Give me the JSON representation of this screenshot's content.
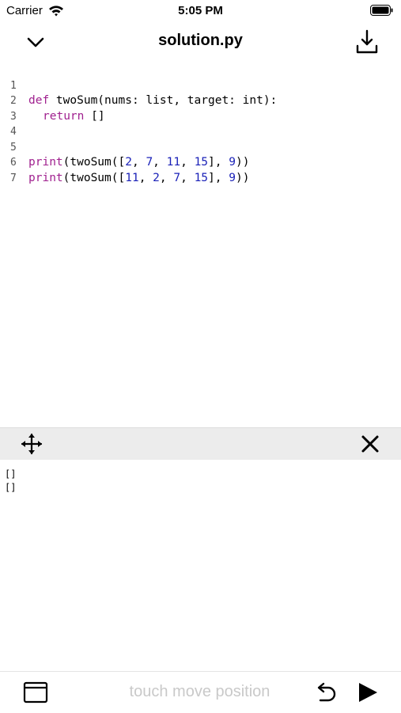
{
  "status_bar": {
    "carrier": "Carrier",
    "time": "5:05 PM"
  },
  "nav": {
    "title": "solution.py",
    "back_icon": "chevron-down-icon",
    "download_icon": "download-icon"
  },
  "editor": {
    "lines": [
      {
        "number": "1"
      },
      {
        "number": "2"
      },
      {
        "number": "3"
      },
      {
        "number": "4"
      },
      {
        "number": "5"
      },
      {
        "number": "6"
      },
      {
        "number": "7"
      }
    ],
    "tokens": {
      "l1_def": "def",
      "l1_rest": " twoSum(nums: list, target: int):",
      "l2_return": "return",
      "l2_rest": " []",
      "l5_print": "print",
      "l5_a": "(twoSum([",
      "l5_n1": "2",
      "l5_c1": ", ",
      "l5_n2": "7",
      "l5_c2": ", ",
      "l5_n3": "11",
      "l5_c3": ", ",
      "l5_n4": "15",
      "l5_c4": "], ",
      "l5_n5": "9",
      "l5_end": "))",
      "l6_print": "print",
      "l6_a": "(twoSum([",
      "l6_n1": "11",
      "l6_c1": ", ",
      "l6_n2": "2",
      "l6_c2": ", ",
      "l6_n3": "7",
      "l6_c3": ", ",
      "l6_n4": "15",
      "l6_c4": "], ",
      "l6_n5": "9",
      "l6_end": "))"
    }
  },
  "console": {
    "output": [
      "[]",
      "[]"
    ]
  },
  "toolbar": {
    "hint": "touch move position"
  },
  "colors": {
    "keyword": "#a0218f",
    "number": "#1b22b8",
    "console_bar": "#ececec",
    "hint": "#c9c9c9"
  }
}
